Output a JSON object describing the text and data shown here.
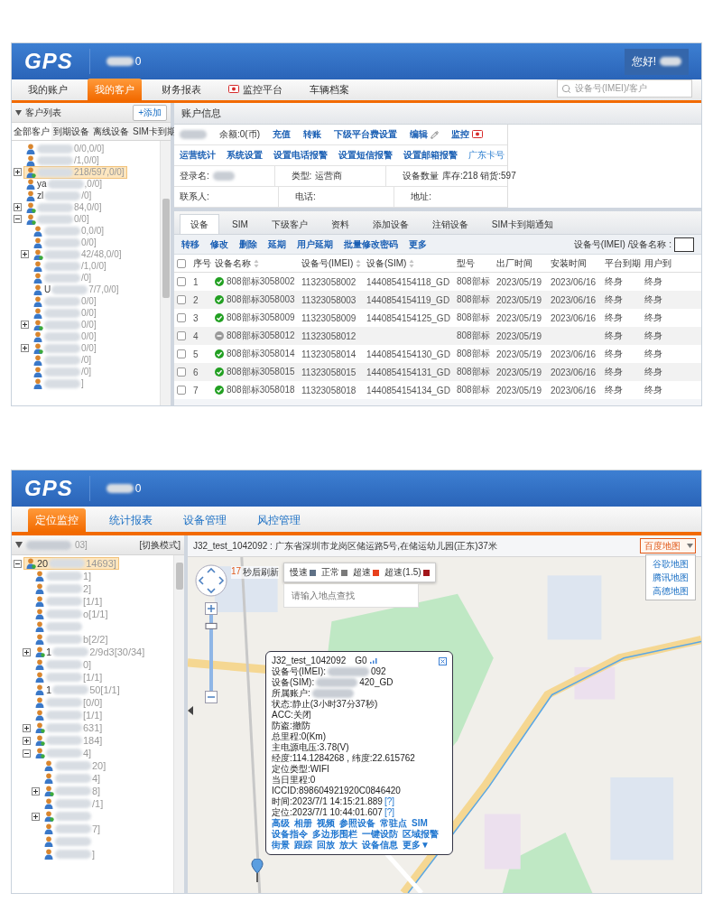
{
  "account_screen": {
    "header": {
      "logo": "GPS",
      "user_fragment": "0",
      "greeting": "您好!"
    },
    "nav": {
      "tabs": [
        {
          "label": "我的账户",
          "selected": false,
          "has_icon": false
        },
        {
          "label": "我的客户",
          "selected": true,
          "has_icon": false
        },
        {
          "label": "财务报表",
          "selected": false,
          "has_icon": false
        },
        {
          "label": "监控平台",
          "selected": false,
          "has_icon": true
        },
        {
          "label": "车辆档案",
          "selected": false,
          "has_icon": false
        }
      ],
      "search": {
        "placeholder": "设备号(IMEI)/客户"
      }
    },
    "sidebar": {
      "title": "客户列表",
      "add_button": "+添加",
      "tabs": [
        {
          "label": "全部客户",
          "selected": true
        },
        {
          "label": "到期设备",
          "selected": false
        },
        {
          "label": "离线设备",
          "selected": false
        },
        {
          "label": "SIM卡到期",
          "selected": false
        }
      ],
      "tree": [
        {
          "end": "0/0,0/0]",
          "kind": "leaf",
          "selected": false
        },
        {
          "end": "/1,0/0]",
          "kind": "leaf",
          "selected": false
        },
        {
          "end": "218/597,0/0]",
          "kind": "group",
          "expanded": false,
          "selected": true
        },
        {
          "start": "ya",
          "end": ",0/0]",
          "kind": "leaf",
          "selected": false
        },
        {
          "start": "zl",
          "end": "/0]",
          "kind": "leaf",
          "selected": false
        },
        {
          "end": "84,0/0]",
          "kind": "group",
          "expanded": false,
          "selected": false
        },
        {
          "end": "0/0]",
          "kind": "group",
          "expanded": true,
          "selected": false,
          "children": [
            {
              "end": "0,0/0]",
              "kind": "leaf",
              "selected": false
            },
            {
              "end": "0/0]",
              "kind": "leaf",
              "selected": false
            },
            {
              "end": "42/48,0/0]",
              "kind": "group",
              "expanded": false,
              "selected": false
            },
            {
              "end": "/1,0/0]",
              "kind": "leaf",
              "selected": false
            },
            {
              "end": "/0]",
              "kind": "leaf",
              "selected": false
            },
            {
              "start": "U",
              "end": "7/7,0/0]",
              "kind": "leaf",
              "selected": false
            },
            {
              "end": "0/0]",
              "kind": "leaf",
              "selected": false
            },
            {
              "end": "0/0]",
              "kind": "leaf",
              "selected": false
            },
            {
              "end": "0/0]",
              "kind": "group",
              "expanded": false,
              "selected": false
            },
            {
              "end": "0/0]",
              "kind": "leaf",
              "selected": false
            },
            {
              "end": "0/0]",
              "kind": "group",
              "expanded": false,
              "selected": false
            },
            {
              "end": "/0]",
              "kind": "leaf",
              "selected": false
            },
            {
              "end": "/0]",
              "kind": "leaf",
              "selected": false
            },
            {
              "end": "]",
              "kind": "leaf",
              "selected": false
            }
          ]
        }
      ]
    },
    "account_info": {
      "title": "账户信息",
      "balance": "余额:0(币)",
      "links": [
        {
          "label": "充值",
          "kind": "plain"
        },
        {
          "label": "转账",
          "kind": "plain"
        },
        {
          "label": "下级平台费设置",
          "kind": "plain"
        },
        {
          "label": "编辑",
          "kind": "edit"
        },
        {
          "label": "监控",
          "kind": "monitor"
        }
      ],
      "settings": [
        {
          "label": "运营统计",
          "kind": "bold"
        },
        {
          "label": "系统设置",
          "kind": "bold"
        },
        {
          "label": "设置电话报警",
          "kind": "bold"
        },
        {
          "label": "设置短信报警",
          "kind": "bold"
        },
        {
          "label": "设置邮箱报警",
          "kind": "bold"
        },
        {
          "label": "广东卡号",
          "kind": "light"
        }
      ],
      "details": [
        {
          "label": "登录名:",
          "redacted": true
        },
        {
          "label": "类型:",
          "value": "运营商",
          "redacted": false
        },
        {
          "label": "设备数量",
          "value": "库存:218 销货:597",
          "redacted": false
        },
        {
          "label": "联系人:",
          "redacted": false
        },
        {
          "label": "电话:",
          "redacted": false
        },
        {
          "label": "地址:",
          "redacted": false
        }
      ]
    },
    "device_tabs": [
      {
        "label": "设备",
        "selected": true
      },
      {
        "label": "SIM",
        "selected": false
      },
      {
        "label": "下级客户",
        "selected": false
      },
      {
        "label": "资料",
        "selected": false
      },
      {
        "label": "添加设备",
        "selected": false
      },
      {
        "label": "注销设备",
        "selected": false
      },
      {
        "label": "SIM卡到期通知",
        "selected": false
      }
    ],
    "actions": [
      "转移",
      "修改",
      "删除",
      "延期",
      "用户延期",
      "批量修改密码",
      "更多"
    ],
    "device_search_label": "设备号(IMEI) /设备名称 :",
    "table": {
      "header_checked": false,
      "columns": [
        {
          "label": "序号",
          "sortable": false
        },
        {
          "label": "设备名称",
          "sortable": true
        },
        {
          "label": "设备号(IMEI)",
          "sortable": true
        },
        {
          "label": "设备(SIM)",
          "sortable": true
        },
        {
          "label": "型号",
          "sortable": false
        },
        {
          "label": "出厂时间",
          "sortable": false
        },
        {
          "label": "安装时间",
          "sortable": false
        },
        {
          "label": "平台到期",
          "sortable": false
        },
        {
          "label": "用户到",
          "sortable": false
        }
      ],
      "rows": [
        {
          "checked": false,
          "online": true,
          "cells": [
            "1",
            "808部标3058002",
            "11323058002",
            "1440854154118_GD",
            "808部标",
            "2023/05/19",
            "2023/06/16",
            "终身",
            "终身"
          ]
        },
        {
          "checked": false,
          "online": true,
          "cells": [
            "2",
            "808部标3058003",
            "11323058003",
            "1440854154119_GD",
            "808部标",
            "2023/05/19",
            "2023/06/16",
            "终身",
            "终身"
          ]
        },
        {
          "checked": false,
          "online": true,
          "cells": [
            "3",
            "808部标3058009",
            "11323058009",
            "1440854154125_GD",
            "808部标",
            "2023/05/19",
            "2023/06/16",
            "终身",
            "终身"
          ]
        },
        {
          "checked": false,
          "online": false,
          "cells": [
            "4",
            "808部标3058012",
            "11323058012",
            "",
            "808部标",
            "2023/05/19",
            "",
            "终身",
            "终身"
          ]
        },
        {
          "checked": false,
          "online": true,
          "cells": [
            "5",
            "808部标3058014",
            "11323058014",
            "1440854154130_GD",
            "808部标",
            "2023/05/19",
            "2023/06/16",
            "终身",
            "终身"
          ]
        },
        {
          "checked": false,
          "online": true,
          "cells": [
            "6",
            "808部标3058015",
            "11323058015",
            "1440854154131_GD",
            "808部标",
            "2023/05/19",
            "2023/06/16",
            "终身",
            "终身"
          ]
        },
        {
          "checked": false,
          "online": true,
          "cells": [
            "7",
            "808部标3058018",
            "11323058018",
            "1440854154134_GD",
            "808部标",
            "2023/05/19",
            "2023/06/16",
            "终身",
            "终身"
          ]
        }
      ]
    }
  },
  "monitor_screen": {
    "header": {
      "logo": "GPS",
      "user_fragment": "0"
    },
    "nav": {
      "tabs": [
        {
          "label": "定位监控",
          "selected": true
        },
        {
          "label": "统计报表",
          "selected": false
        },
        {
          "label": "设备管理",
          "selected": false
        },
        {
          "label": "风控管理",
          "selected": false
        }
      ]
    },
    "tree_panel": {
      "title_fragment": "03]",
      "mode_button": "[切换模式]",
      "tree": [
        {
          "start": "20",
          "end": "14693]",
          "kind": "group",
          "expanded": true,
          "selected": true,
          "children": [
            {
              "end": "1]",
              "kind": "leaf",
              "selected": false
            },
            {
              "end": "2]",
              "kind": "leaf",
              "selected": false
            },
            {
              "end": "[1/1]",
              "kind": "leaf",
              "selected": false
            },
            {
              "end": "o[1/1]",
              "kind": "leaf",
              "selected": false
            },
            {
              "kind": "leaf",
              "selected": false
            },
            {
              "end": "b[2/2]",
              "kind": "leaf",
              "selected": false
            },
            {
              "start": "1",
              "end": "2/9d3[30/34]",
              "kind": "group",
              "expanded": false,
              "selected": false
            },
            {
              "end": "0]",
              "kind": "leaf",
              "selected": false
            },
            {
              "end": "[1/1]",
              "kind": "leaf",
              "selected": false
            },
            {
              "start": "1",
              "end": "50[1/1]",
              "kind": "leaf",
              "selected": false
            },
            {
              "end": "[0/0]",
              "kind": "leaf",
              "selected": false
            },
            {
              "end": "[1/1]",
              "kind": "leaf",
              "selected": false
            },
            {
              "end": "631]",
              "kind": "group",
              "expanded": false,
              "selected": false
            },
            {
              "end": "184]",
              "kind": "group",
              "expanded": false,
              "selected": false
            },
            {
              "end": "4]",
              "kind": "group",
              "expanded": true,
              "selected": false,
              "children": [
                {
                  "end": "20]",
                  "kind": "leaf",
                  "selected": false
                },
                {
                  "end": "4]",
                  "kind": "leaf",
                  "selected": false
                },
                {
                  "end": "8]",
                  "kind": "group",
                  "expanded": false,
                  "selected": false
                },
                {
                  "end": "/1]",
                  "kind": "leaf",
                  "selected": false
                },
                {
                  "kind": "group",
                  "expanded": false,
                  "selected": false
                },
                {
                  "end": "7]",
                  "kind": "leaf",
                  "selected": false
                },
                {
                  "kind": "leaf",
                  "selected": false
                },
                {
                  "end": "]",
                  "kind": "leaf",
                  "selected": false
                }
              ]
            }
          ]
        }
      ]
    },
    "address": "J32_test_1042092 : 广东省深圳市龙岗区储运路5号,在储运幼儿园(正东)37米",
    "map_type": {
      "value": "百度地图",
      "expanded": true,
      "options": [
        "谷歌地图",
        "腾讯地图",
        "高德地图"
      ]
    },
    "zoom": {
      "level": 0.88
    },
    "refresh": {
      "countdown": "17",
      "label": "秒后刷新"
    },
    "legend": [
      {
        "label": "慢速",
        "color": "#5f7186"
      },
      {
        "label": "正常",
        "color": "#7a7a7a"
      },
      {
        "label": "超速",
        "color": "#e8401c"
      },
      {
        "label": "超速(1.5)",
        "color": "#a3161a"
      }
    ],
    "place_search": {
      "placeholder": "请输入地点查找"
    },
    "popup": {
      "title": "J32_test_1042092",
      "gps": "G0",
      "lines": [
        {
          "text": "设备号(IMEI):",
          "redacted": true,
          "tail": "092"
        },
        {
          "text": "设备(SIM):",
          "redacted": true,
          "tail": "420_GD"
        },
        {
          "text": "所属账户:",
          "redacted": true
        },
        {
          "text": "状态:静止(3小时37分37秒)",
          "redacted": false
        },
        {
          "text": "ACC:关闭",
          "redacted": false
        },
        {
          "text": "防盗:撤防",
          "redacted": false
        },
        {
          "text": "总里程:0(Km)",
          "redacted": false
        },
        {
          "text": "主电源电压:3.78(V)",
          "redacted": false
        },
        {
          "text": "经度:114.1284268 , 纬度:22.615762",
          "redacted": false
        },
        {
          "text": "定位类型:WIFI",
          "redacted": false
        },
        {
          "text": "当日里程:0",
          "redacted": false
        },
        {
          "text": "ICCID:898604921920C0846420",
          "redacted": false
        },
        {
          "text": "时间:2023/7/1 14:15:21.889",
          "redacted": false,
          "help": "[?]"
        },
        {
          "text": "定位:2023/7/1 10:44:01.607",
          "redacted": false,
          "help": "[?]"
        }
      ],
      "actions": [
        [
          "高级",
          "相册",
          "视频",
          "参照设备",
          "常驻点",
          "SIM"
        ],
        [
          "设备指令",
          "多边形围栏",
          "一键设防",
          "区域报警"
        ],
        [
          "街景",
          "跟踪",
          "回放",
          "放大",
          "设备信息",
          "更多▼"
        ]
      ]
    }
  }
}
